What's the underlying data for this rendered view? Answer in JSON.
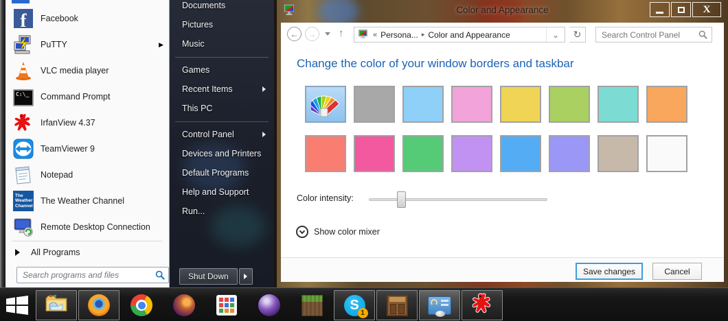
{
  "start_menu": {
    "left_items": [
      {
        "label": "Facebook",
        "icon": "facebook-icon"
      },
      {
        "label": "PuTTY",
        "icon": "putty-icon",
        "submenu": true
      },
      {
        "label": "VLC media player",
        "icon": "vlc-icon"
      },
      {
        "label": "Command Prompt",
        "icon": "command-prompt-icon"
      },
      {
        "label": "IrfanView 4.37",
        "icon": "irfanview-icon"
      },
      {
        "label": "TeamViewer 9",
        "icon": "teamviewer-icon"
      },
      {
        "label": "Notepad",
        "icon": "notepad-icon"
      },
      {
        "label": "The Weather Channel",
        "icon": "weather-channel-icon"
      },
      {
        "label": "Remote Desktop Connection",
        "icon": "remote-desktop-icon"
      }
    ],
    "all_programs": {
      "label": "All Programs"
    },
    "search": {
      "placeholder": "Search programs and files"
    },
    "right_items": [
      {
        "label": "Documents"
      },
      {
        "label": "Pictures"
      },
      {
        "label": "Music",
        "divider_after": true
      },
      {
        "label": "Games"
      },
      {
        "label": "Recent Items",
        "submenu": true
      },
      {
        "label": "This PC",
        "divider_after": true
      },
      {
        "label": "Control Panel",
        "submenu": true
      },
      {
        "label": "Devices and Printers"
      },
      {
        "label": "Default Programs"
      },
      {
        "label": "Help and Support"
      },
      {
        "label": "Run..."
      }
    ],
    "shut_down": {
      "label": "Shut Down"
    }
  },
  "window": {
    "title": "Color and Appearance",
    "address": {
      "overflow_glyph": "«",
      "parent": "Persona...",
      "separator_glyph": "▸",
      "current": "Color and Appearance",
      "dropdown_glyph": "⌄",
      "refresh_glyph": "↻",
      "back_glyph": "←",
      "forward_glyph": "→",
      "up_glyph": "↑",
      "search_glyph": "⌕"
    },
    "search": {
      "placeholder": "Search Control Panel"
    },
    "heading": "Change the color of your window borders and taskbar",
    "swatches_row1": [
      {
        "name": "automatic",
        "selected": true
      },
      {
        "color": "#a8a8a8"
      },
      {
        "color": "#8ed0f8"
      },
      {
        "color": "#f2a4da"
      },
      {
        "color": "#f0d455"
      },
      {
        "color": "#aad061"
      },
      {
        "color": "#7cdcd4"
      },
      {
        "color": "#f9a75d"
      }
    ],
    "swatches_row2": [
      {
        "color": "#fa7d72"
      },
      {
        "color": "#f2599f"
      },
      {
        "color": "#55cb77"
      },
      {
        "color": "#c292f3"
      },
      {
        "color": "#54acf4"
      },
      {
        "color": "#9b97f6"
      },
      {
        "color": "#c7b9a9"
      },
      {
        "color": "#fbfafa"
      }
    ],
    "intensity": {
      "label": "Color intensity:",
      "percent": 18
    },
    "mixer": {
      "label": "Show color mixer"
    },
    "footer": {
      "save_label": "Save changes",
      "cancel_label": "Cancel"
    },
    "accent_heading": "#1a63b5"
  },
  "taskbar": {
    "icons": [
      {
        "name": "file-explorer",
        "open": true
      },
      {
        "name": "firefox",
        "open": true
      },
      {
        "name": "chrome",
        "open": false
      },
      {
        "name": "pale-moon",
        "open": false
      },
      {
        "name": "app-grid",
        "open": false
      },
      {
        "name": "eclipse",
        "open": false
      },
      {
        "name": "minecraft",
        "open": false
      },
      {
        "name": "skype",
        "open": true,
        "badge": "1"
      },
      {
        "name": "crafting-table",
        "open": true
      },
      {
        "name": "display-settings",
        "open": true,
        "active": true
      },
      {
        "name": "irfanview",
        "open": true
      }
    ]
  }
}
